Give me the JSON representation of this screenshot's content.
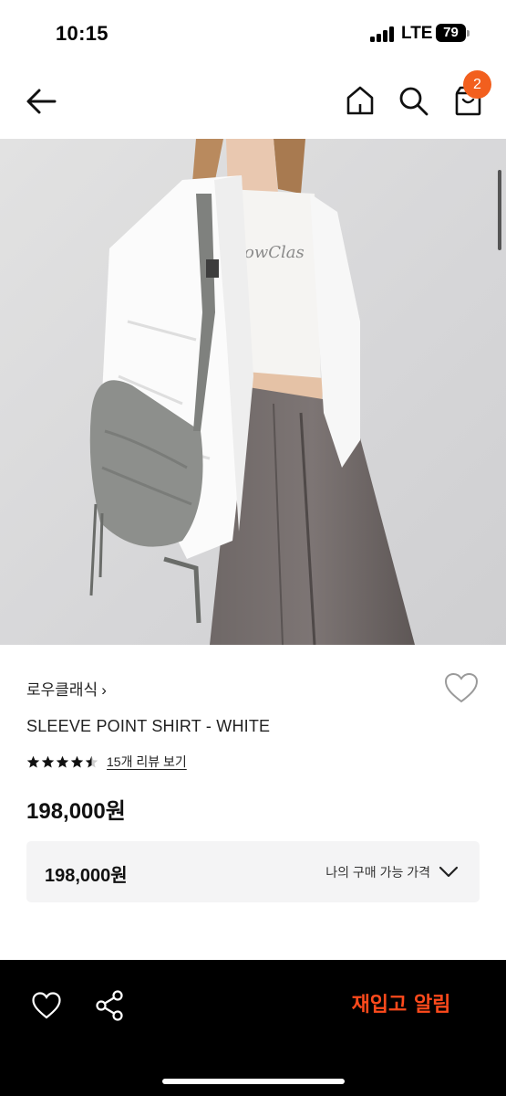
{
  "status_bar": {
    "time": "10:15",
    "network": "LTE",
    "battery": "79"
  },
  "header": {
    "icons": [
      "arrow-left-icon",
      "home-icon",
      "search-icon",
      "shopping-bag-icon"
    ],
    "cart_count": "2",
    "accent_color": "#f25f1e"
  },
  "product": {
    "image_icon": "product-photo",
    "brand": "로우클래식",
    "brand_chevron": "›",
    "name": "SLEEVE POINT SHIRT - WHITE",
    "rating": 4.5,
    "rating_max": 5,
    "review_link": "15개 리뷰 보기",
    "price": "198,000원"
  },
  "price_box": {
    "value": "198,000원",
    "label": "나의 구매 가능 가격"
  },
  "bottom_bar": {
    "icons": [
      "heart-outline-icon",
      "share-icon"
    ],
    "restock_label": "재입고 알림",
    "restock_color": "#ff4a1c"
  }
}
